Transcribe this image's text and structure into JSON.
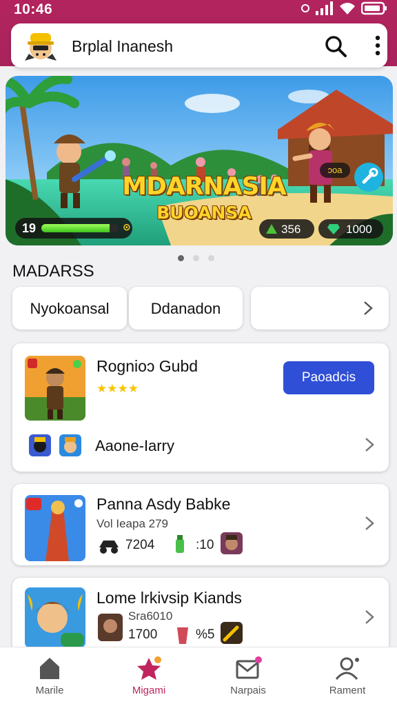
{
  "status_bar": {
    "time": "10:46"
  },
  "header": {
    "title": "Brplal Inanesh"
  },
  "banner": {
    "title": "MDARNASIA",
    "subtitle": "BUOANSA",
    "top_badge": "ɔoa",
    "level": "19",
    "level_progress": 0.88,
    "coins": "356",
    "gems": "1000"
  },
  "carousel": {
    "pages": 3,
    "active": 0
  },
  "section": {
    "title": "MADARSS"
  },
  "chips": [
    {
      "label": "Nyokoansal"
    },
    {
      "label": "Ddanadon"
    },
    {
      "label": ""
    }
  ],
  "cards": [
    {
      "title": "Rognioɔ Gubd",
      "rating": "★★★★",
      "action": "Paoadcis",
      "sub": "Aaone-Iarry"
    },
    {
      "title": "Panna Asdy Babke",
      "subline": "Vol Ieapa 279",
      "stat1": "7204",
      "stat2": ":10"
    },
    {
      "title": "Lome lrkivsip Kiands",
      "subline": "Sra6010",
      "stat1": "1700",
      "stat2": "%5"
    }
  ],
  "bottom_nav": [
    {
      "label": "Marile",
      "icon": "home-icon"
    },
    {
      "label": "Migami",
      "icon": "star-icon"
    },
    {
      "label": "Narpais",
      "icon": "mail-icon"
    },
    {
      "label": "Rament",
      "icon": "profile-icon"
    }
  ],
  "colors": {
    "status": "#b3245f",
    "accent": "#c0245e",
    "button": "#2f4fd6"
  }
}
